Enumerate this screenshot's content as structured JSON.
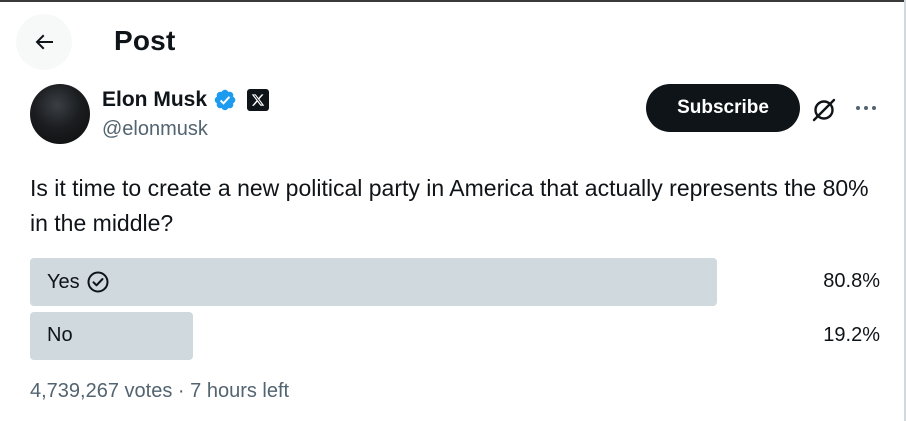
{
  "header": {
    "title": "Post"
  },
  "author": {
    "name": "Elon Musk",
    "handle": "@elonmusk"
  },
  "actions": {
    "subscribe_label": "Subscribe"
  },
  "post": {
    "text": "Is it time to create a new political party in America that actually represents the 80% in the middle?"
  },
  "poll": {
    "options": [
      {
        "label": "Yes",
        "percent_label": "80.8%",
        "fraction": 0.808,
        "winner": true
      },
      {
        "label": "No",
        "percent_label": "19.2%",
        "fraction": 0.192,
        "winner": false
      }
    ],
    "votes": "4,739,267 votes",
    "separator": "·",
    "time_left": "7 hours left"
  },
  "icons": {
    "back": "arrow-left-icon",
    "verified": "verified-badge-icon",
    "affiliate": "x-logo-icon",
    "grok": "grok-icon",
    "more": "more-icon",
    "check": "check-circle-icon"
  },
  "colors": {
    "text": "#0f1419",
    "secondary": "#536471",
    "verified": "#1d9bf0",
    "poll_bar": "#cfd9de",
    "button_bg": "#0f1419"
  }
}
